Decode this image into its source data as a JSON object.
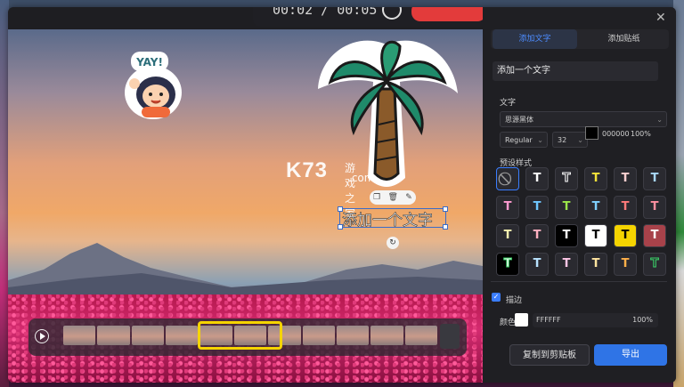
{
  "hud": {
    "time_text": "00:02 / 00:05"
  },
  "watermark": {
    "brand": "K73",
    "cn": "游戏之家",
    "domain": ".com"
  },
  "sticker_yay": {
    "text": "YAY!"
  },
  "canvas_text": "添加一个文字",
  "window": {
    "close_symbol": "✕"
  },
  "panel": {
    "tabs": [
      {
        "label": "添加文字"
      },
      {
        "label": "添加贴纸"
      }
    ],
    "text_input_value": "添加一个文字",
    "text_section_label": "文字",
    "font_family": "思源黑体",
    "font_weight": "Regular",
    "font_size": "32",
    "color_hex": "000000",
    "opacity": "100%",
    "preset_label": "预设样式",
    "stroke_label": "描边",
    "stroke_color_label": "颜色",
    "stroke_color_hex": "FFFFFF",
    "stroke_opacity": "100%",
    "copy_button": "复制到剪贴板",
    "export_button": "导出"
  },
  "presets": [
    {
      "glyph": "⃠",
      "color": "#9a9a9a",
      "bg": "#2a2a30"
    },
    {
      "glyph": "T",
      "color": "#ffffff",
      "bg": "#2a2a30"
    },
    {
      "glyph": "T",
      "color": "#2a2a30",
      "bg": "#2a2a30",
      "outline": "#ffffff"
    },
    {
      "glyph": "T",
      "color": "#f2e23a",
      "bg": "#2a2a30"
    },
    {
      "glyph": "T",
      "color": "#ffd0d0",
      "bg": "#2a2a30"
    },
    {
      "glyph": "T",
      "color": "#a9d8ff",
      "bg": "#2a2a30"
    },
    {
      "glyph": "T",
      "color": "#ff9ad0",
      "bg": "#2a2a30"
    },
    {
      "glyph": "T",
      "color": "#6fc7ff",
      "bg": "#2a2a30"
    },
    {
      "glyph": "T",
      "color": "#9be64a",
      "bg": "#2a2a30"
    },
    {
      "glyph": "T",
      "color": "#7fd0ff",
      "bg": "#2a2a30"
    },
    {
      "glyph": "T",
      "color": "#ff7a7a",
      "bg": "#2a2a30"
    },
    {
      "glyph": "T",
      "color": "#ff8fa0",
      "bg": "#2a2a30"
    },
    {
      "glyph": "T",
      "color": "#f5f0b0",
      "bg": "#2a2a30"
    },
    {
      "glyph": "T",
      "color": "#ffb0c0",
      "bg": "#2a2a30"
    },
    {
      "glyph": "T",
      "color": "#ffffff",
      "bg": "#000000"
    },
    {
      "glyph": "T",
      "color": "#000000",
      "bg": "#ffffff"
    },
    {
      "glyph": "T",
      "color": "#000000",
      "bg": "#f5d400"
    },
    {
      "glyph": "T",
      "color": "#ffffff",
      "bg": "#a8424a"
    },
    {
      "glyph": "T",
      "color": "#ffffff",
      "bg": "#000000",
      "outline": "#3bd76a"
    },
    {
      "glyph": "T",
      "color": "#b9e3ff",
      "bg": "#2a2a30"
    },
    {
      "glyph": "T",
      "color": "#ffc6e6",
      "bg": "#2a2a30"
    },
    {
      "glyph": "T",
      "color": "#ffe4a0",
      "bg": "#2a2a30"
    },
    {
      "glyph": "T",
      "color": "#ffb04a",
      "bg": "#2a2a30"
    },
    {
      "glyph": "T",
      "color": "#2a2a30",
      "bg": "#2a2a30",
      "outline": "#3bd76a"
    }
  ]
}
